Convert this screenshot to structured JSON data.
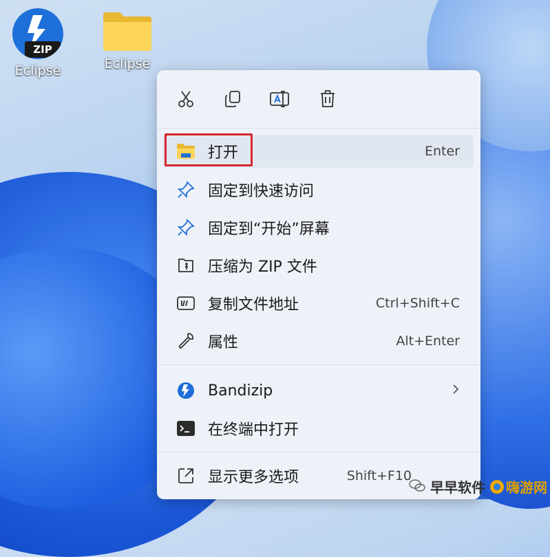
{
  "desktop": {
    "icons": [
      {
        "label": "Eclipse",
        "type": "zip-archive",
        "badge": "ZIP"
      },
      {
        "label": "Eclipse",
        "type": "folder"
      }
    ]
  },
  "context_menu": {
    "toolbar": [
      {
        "icon": "cut-icon"
      },
      {
        "icon": "copy-icon"
      },
      {
        "icon": "rename-icon"
      },
      {
        "icon": "delete-icon"
      }
    ],
    "items": [
      {
        "label": "打开",
        "shortcut": "Enter",
        "icon": "folder-icon",
        "highlighted": true
      },
      {
        "label": "固定到快速访问",
        "shortcut": "",
        "icon": "pin-icon"
      },
      {
        "label": "固定到“开始”屏幕",
        "shortcut": "",
        "icon": "pin-icon"
      },
      {
        "label": "压缩为 ZIP 文件",
        "shortcut": "",
        "icon": "zip-file-icon"
      },
      {
        "label": "复制文件地址",
        "shortcut": "Ctrl+Shift+C",
        "icon": "copy-path-icon"
      },
      {
        "label": "属性",
        "shortcut": "Alt+Enter",
        "icon": "wrench-icon"
      },
      {
        "label": "Bandizip",
        "shortcut": "",
        "icon": "bandizip-icon",
        "submenu": true
      },
      {
        "label": "在终端中打开",
        "shortcut": "",
        "icon": "terminal-icon"
      },
      {
        "label": "显示更多选项",
        "shortcut": "Shift+F10",
        "icon": "more-options-icon"
      }
    ]
  },
  "watermark": {
    "text": "早早软件",
    "logo_text": "嗨游网"
  },
  "colors": {
    "accent": "#1e6fd9",
    "highlight_border": "#d8262d",
    "menu_bg": "#eef2f8"
  }
}
